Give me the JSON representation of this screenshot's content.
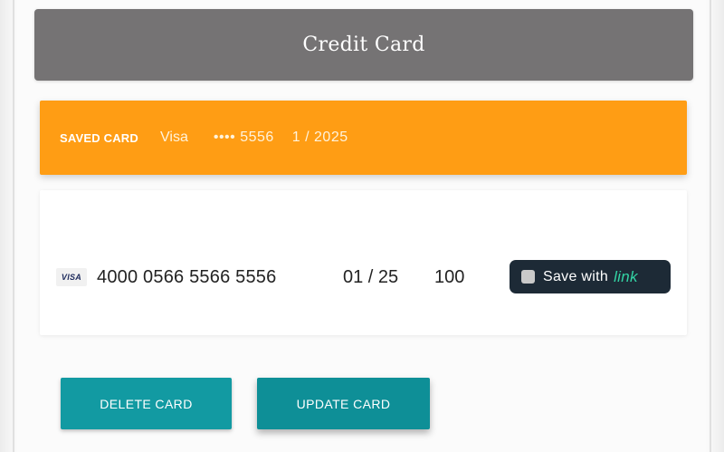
{
  "header": {
    "title": "Credit Card"
  },
  "saved_card": {
    "label": "SAVED CARD",
    "brand": "Visa",
    "masked_number": "•••• 5556",
    "expiry": "1 / 2025",
    "background_color": "#ff9d14"
  },
  "card_form": {
    "brand_logo_text": "VISA",
    "card_number": "4000 0566 5566 5556",
    "expiry": "01 / 25",
    "cvc": "100",
    "link_toggle": {
      "label": "Save with",
      "brand": "link",
      "checked": false
    }
  },
  "actions": {
    "delete_label": "DELETE CARD",
    "update_label": "UPDATE CARD",
    "button_color": "#129aa2"
  },
  "icons": {
    "card_brand": "visa-icon",
    "checkbox": "checkbox-icon"
  }
}
